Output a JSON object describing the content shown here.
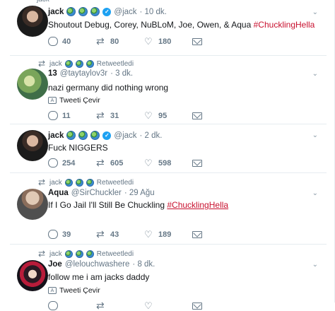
{
  "retweet_label": "Retweetledi",
  "translate_label": "Tweeti Çevir",
  "tweets": [
    {
      "retweeted_by": "jack",
      "name": "jack",
      "handle": "@jack",
      "time": "· 10 dk.",
      "text": "Shoutout Debug, Corey, NuBLoM, Joe, Owen, & Aqua ",
      "hashtag": "#ChucklingHella",
      "replies": "40",
      "retweets": "80",
      "likes": "180"
    },
    {
      "retweeted_by": "jack",
      "name": "13",
      "handle": "@taytaylov3r",
      "time": "· 3 dk.",
      "text": "nazi germany did nothing wrong",
      "replies": "11",
      "retweets": "31",
      "likes": "95"
    },
    {
      "name": "jack",
      "handle": "@jack",
      "time": "· 2 dk.",
      "text": "Fuck NIGGERS",
      "replies": "254",
      "retweets": "605",
      "likes": "598"
    },
    {
      "retweeted_by": "jack",
      "name": "Aqua",
      "handle": "@SirChuckler",
      "time": "· 29 Ağu",
      "text": "If I Go Jail I'll Still Be Chuckling ",
      "hashtag": "#ChucklingHella",
      "replies": "39",
      "retweets": "43",
      "likes": "189"
    },
    {
      "retweeted_by": "jack",
      "name": "Joe",
      "handle": "@lelouchwashere",
      "time": "· 8 dk.",
      "text": "follow me i am jacks daddy"
    }
  ],
  "icons": {
    "reply": "reply-icon",
    "retweet": "retweet-icon",
    "like": "heart-icon",
    "dm": "envelope-icon",
    "verified": "verified-badge-icon",
    "globe": "globe-emoji-icon",
    "translate": "translate-icon",
    "chevron": "chevron-down-icon"
  },
  "colors": {
    "hashtag": "#c8102e",
    "muted": "#657786",
    "verified": "#1da1f2"
  }
}
